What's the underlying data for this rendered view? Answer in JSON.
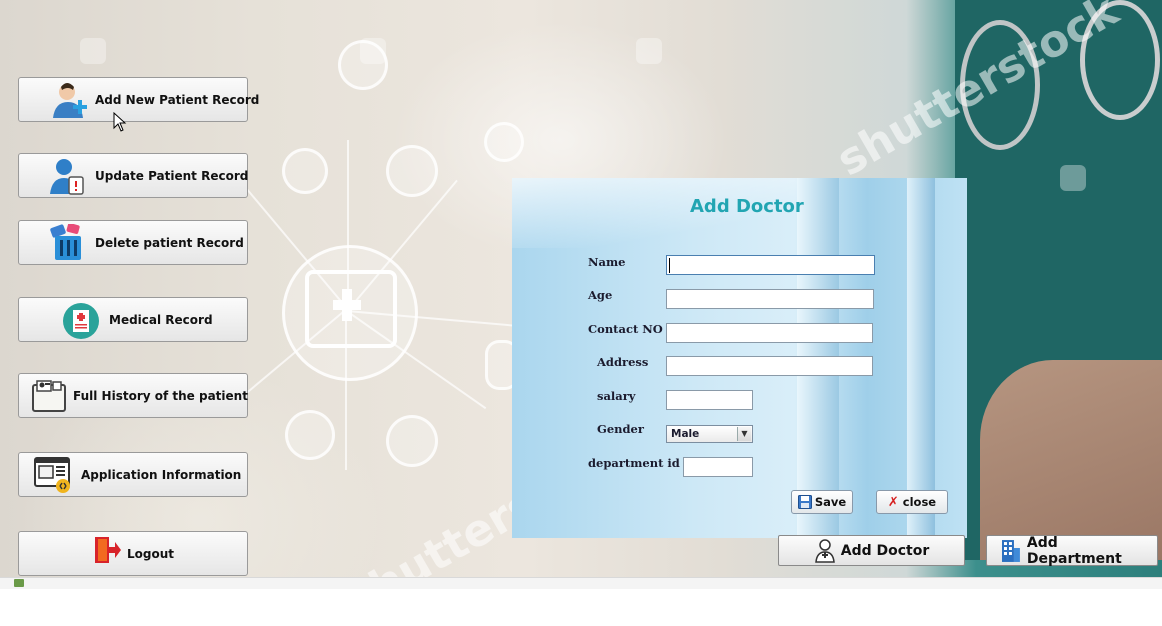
{
  "sidebar": {
    "buttons": [
      {
        "label": "Add New Patient Record"
      },
      {
        "label": "Update Patient Record"
      },
      {
        "label": "Delete patient Record"
      },
      {
        "label": "Medical Record"
      },
      {
        "label": "Full History of the patient"
      },
      {
        "label": "Application Information"
      },
      {
        "label": "Logout"
      }
    ]
  },
  "background": {
    "watermark": "shutterstock"
  },
  "dialog": {
    "title": "Add Doctor",
    "fields": {
      "name": {
        "label": "Name",
        "value": ""
      },
      "age": {
        "label": "Age",
        "value": ""
      },
      "contact": {
        "label": "Contact NO",
        "value": ""
      },
      "address": {
        "label": "Address",
        "value": ""
      },
      "salary": {
        "label": "salary",
        "value": ""
      },
      "gender": {
        "label": "Gender",
        "value": "Male"
      },
      "department_id": {
        "label": "department id",
        "value": ""
      }
    },
    "save_label": "Save",
    "close_label": "close"
  },
  "bottom_bar": {
    "add_doctor_label": "Add Doctor",
    "add_department_label": "Add Department"
  },
  "colors": {
    "dialog_title": "#22a5b2",
    "scrubs": "#2a7d7a",
    "close_x": "#d61f1f",
    "save_icon": "#3a78c8"
  }
}
